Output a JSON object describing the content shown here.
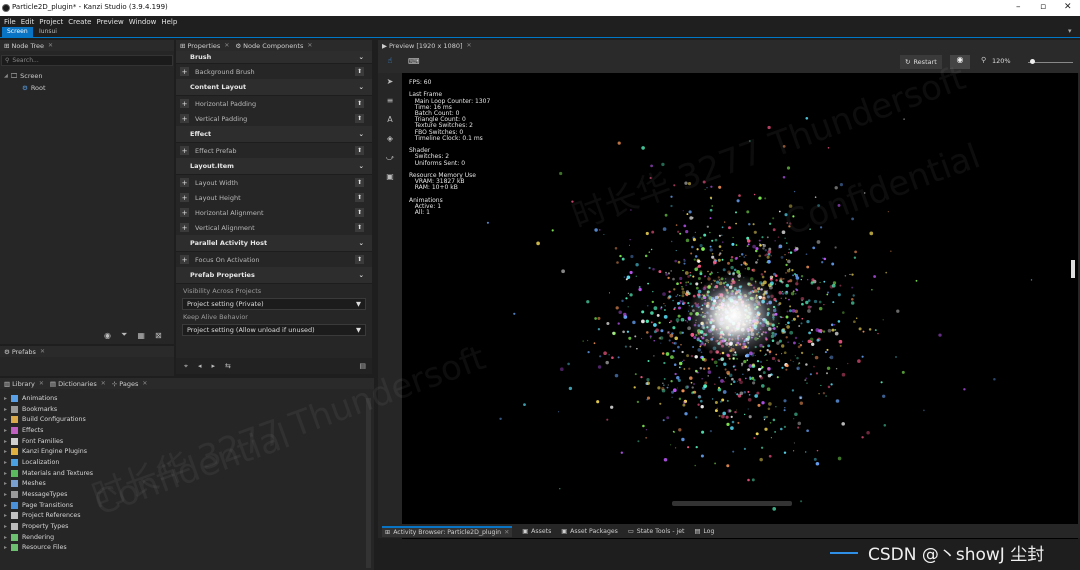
{
  "window": {
    "title": "Particle2D_plugin* - Kanzi Studio (3.9.4.199)"
  },
  "menu": [
    "File",
    "Edit",
    "Project",
    "Create",
    "Preview",
    "Window",
    "Help"
  ],
  "project_tabs": [
    "Screen",
    "Iunsui"
  ],
  "nodetree": {
    "tab": "Node Tree",
    "search_placeholder": "Search...",
    "items": [
      "Screen",
      "Root"
    ]
  },
  "prefabs_tab": "Prefabs",
  "properties": {
    "tabs": [
      "Properties",
      "Node Components"
    ],
    "sections": [
      {
        "title": "Brush",
        "props": [
          "Background Brush"
        ]
      },
      {
        "title": "Content Layout",
        "props": [
          "Horizontal Padding",
          "Vertical Padding"
        ]
      },
      {
        "title": "Effect",
        "props": [
          "Effect Prefab"
        ]
      },
      {
        "title": "Layout.Item",
        "props": [
          "Layout Width",
          "Layout Height",
          "Horizontal Alignment",
          "Vertical Alignment"
        ]
      },
      {
        "title": "Parallel Activity Host",
        "props": [
          "Focus On Activation"
        ]
      },
      {
        "title": "Prefab Properties",
        "props": []
      }
    ],
    "visibility_label": "Visibility Across Projects",
    "visibility_value": "Project setting (Private)",
    "keepalive_label": "Keep Alive Behavior",
    "keepalive_value": "Project setting (Allow unload if unused)"
  },
  "preview": {
    "tab": "Preview [1920 x 1080]",
    "restart": "Restart",
    "zoom": "120%",
    "stats": "FPS: 60\n\nLast Frame\n   Main Loop Counter: 1307\n   Time: 16 ms\n   Batch Count: 0\n   Triangle Count: 0\n   Texture Switches: 2\n   FBO Switches: 0\n   Timeline Clock: 0.1 ms\n\nShader\n   Switches: 2\n   Uniforms Sent: 0\n\nResource Memory Use\n   VRAM: 31827 kB\n   RAM: 10+0 kB\n\nAnimations\n   Active: 1\n   All: 1"
  },
  "library": {
    "tabs": [
      "Library",
      "Dictionaries",
      "Pages"
    ],
    "items": [
      {
        "label": "Animations",
        "color": "#5aa0e6"
      },
      {
        "label": "Bookmarks",
        "color": "#9a9a9a"
      },
      {
        "label": "Build Configurations",
        "color": "#d9a94a"
      },
      {
        "label": "Effects",
        "color": "#c060c0"
      },
      {
        "label": "Font Families",
        "color": "#d0d0d0"
      },
      {
        "label": "Kanzi Engine Plugins",
        "color": "#e0b040"
      },
      {
        "label": "Localization",
        "color": "#4aa0e0"
      },
      {
        "label": "Materials and Textures",
        "color": "#5cb85c"
      },
      {
        "label": "Meshes",
        "color": "#7aa0d0"
      },
      {
        "label": "MessageTypes",
        "color": "#9a9a9a"
      },
      {
        "label": "Page Transitions",
        "color": "#4a90d9"
      },
      {
        "label": "Project References",
        "color": "#c0c0c0"
      },
      {
        "label": "Property Types",
        "color": "#bbbbbb"
      },
      {
        "label": "Rendering",
        "color": "#6cc070"
      },
      {
        "label": "Resource Files",
        "color": "#6cc070"
      }
    ]
  },
  "bottom_tabs": [
    "Activity Browser: Particle2D_plugin",
    "Assets",
    "Asset Packages",
    "State Tools - jet",
    "Log"
  ],
  "watermark": "CSDN @丶showJ 尘封",
  "overlay_watermarks": [
    "时长华 3277 Thundersoft",
    "Confidential"
  ]
}
